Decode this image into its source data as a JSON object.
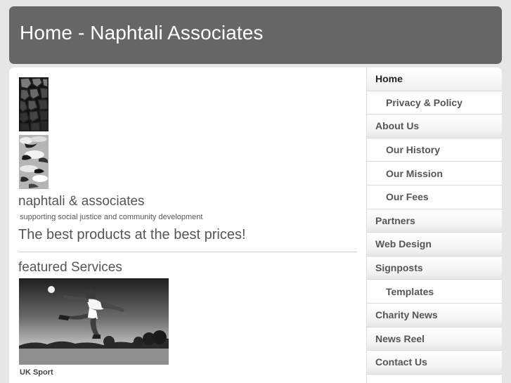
{
  "header": {
    "title": "Home - Naphtali Associates"
  },
  "branding": {
    "site_name": "naphtali & associates",
    "slogan": "supporting social justice and community development",
    "logo_tiles": [
      "cracked-stone-tile",
      "cloud-texture-tile"
    ]
  },
  "main": {
    "tagline": "The best products at the best prices!",
    "featured_title": "featured Services",
    "featured_items": [
      {
        "caption": "UK Sport",
        "image": "football-player-kick-photo"
      }
    ]
  },
  "sidebar": {
    "items": [
      {
        "label": "Home",
        "level": 0,
        "active": true
      },
      {
        "label": "Privacy & Policy",
        "level": 1
      },
      {
        "label": "About Us",
        "level": 0
      },
      {
        "label": "Our History",
        "level": 1
      },
      {
        "label": "Our Mission",
        "level": 1
      },
      {
        "label": "Our Fees",
        "level": 1
      },
      {
        "label": "Partners",
        "level": 0
      },
      {
        "label": "Web Design",
        "level": 0
      },
      {
        "label": "Signposts",
        "level": 0
      },
      {
        "label": "Templates",
        "level": 1
      },
      {
        "label": "Charity News",
        "level": 0
      },
      {
        "label": "News Reel",
        "level": 0
      },
      {
        "label": "Contact Us",
        "level": 0
      }
    ]
  },
  "colors": {
    "header_bg": "#666666",
    "page_bg": "#e6e6e6",
    "text": "#555555"
  }
}
